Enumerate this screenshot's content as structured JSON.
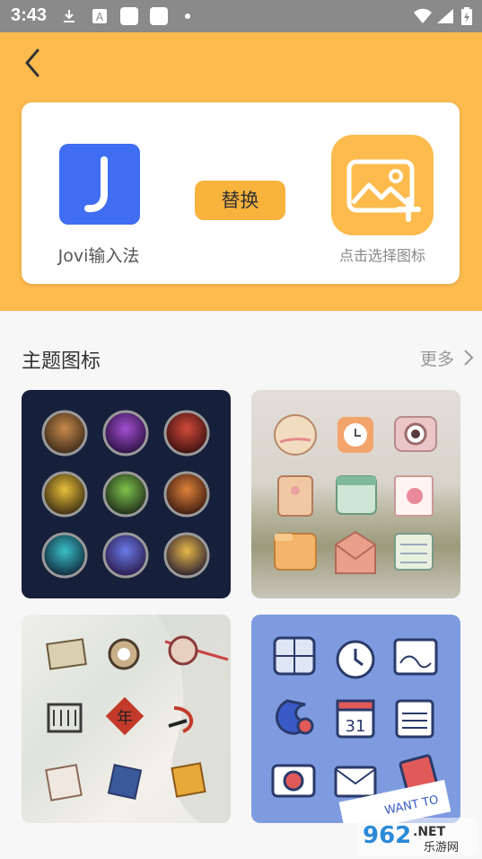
{
  "status_bar": {
    "time": "3:43"
  },
  "header": {
    "back_icon": "chevron-left-icon"
  },
  "replace_card": {
    "app_name": "Jovi输入法",
    "app_icon_letter": "J",
    "swap_label": "替换",
    "pick_label": "点击选择图标",
    "pick_icon": "add-image-icon"
  },
  "section": {
    "title": "主题图标",
    "more_label": "更多"
  },
  "themes": [
    {
      "name": "hero-theme"
    },
    {
      "name": "cute-appliance-theme"
    },
    {
      "name": "ancient-style-theme"
    },
    {
      "name": "blue-cartoon-theme"
    }
  ],
  "watermark": {
    "text1": "962",
    "text2": ".NET",
    "text3": "乐游网"
  },
  "colors": {
    "accent": "#fdbb4e",
    "button": "#f8b33d",
    "app_icon": "#3f6ef2"
  }
}
